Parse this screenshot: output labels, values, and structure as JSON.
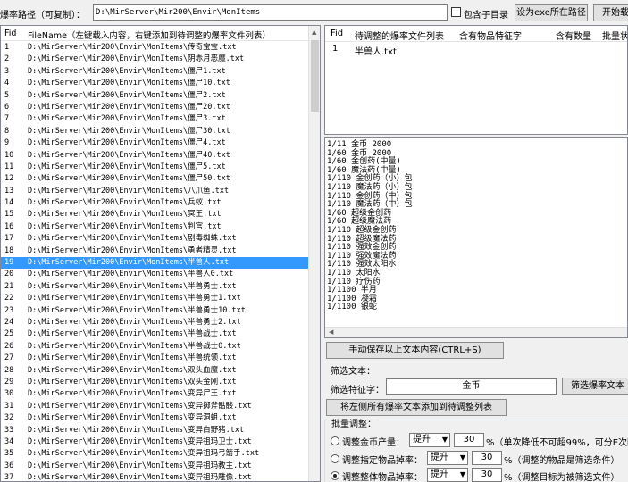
{
  "topbar": {
    "path_label": "爆率路径（可复制）：",
    "path_value": "D:\\MirServer\\Mir200\\Envir\\MonItems",
    "include_subdir_label": "包含子目录",
    "include_subdir_checked": false,
    "set_exe_button": "设为exe所在路径",
    "start_button": "开始载"
  },
  "left_list": {
    "headers": {
      "fid": "Fid",
      "filename": "FileName（左键载入内容，右键添加到待调整的爆率文件列表）"
    },
    "selected_fid": "19",
    "rows": [
      {
        "fid": "1",
        "name": "D:\\MirServer\\Mir200\\Envir\\MonItems\\传奇宝宝.txt"
      },
      {
        "fid": "2",
        "name": "D:\\MirServer\\Mir200\\Envir\\MonItems\\阴赤月恶魔.txt"
      },
      {
        "fid": "3",
        "name": "D:\\MirServer\\Mir200\\Envir\\MonItems\\僵尸1.txt"
      },
      {
        "fid": "4",
        "name": "D:\\MirServer\\Mir200\\Envir\\MonItems\\僵尸10.txt"
      },
      {
        "fid": "5",
        "name": "D:\\MirServer\\Mir200\\Envir\\MonItems\\僵尸2.txt"
      },
      {
        "fid": "6",
        "name": "D:\\MirServer\\Mir200\\Envir\\MonItems\\僵尸20.txt"
      },
      {
        "fid": "7",
        "name": "D:\\MirServer\\Mir200\\Envir\\MonItems\\僵尸3.txt"
      },
      {
        "fid": "8",
        "name": "D:\\MirServer\\Mir200\\Envir\\MonItems\\僵尸30.txt"
      },
      {
        "fid": "9",
        "name": "D:\\MirServer\\Mir200\\Envir\\MonItems\\僵尸4.txt"
      },
      {
        "fid": "10",
        "name": "D:\\MirServer\\Mir200\\Envir\\MonItems\\僵尸40.txt"
      },
      {
        "fid": "11",
        "name": "D:\\MirServer\\Mir200\\Envir\\MonItems\\僵尸5.txt"
      },
      {
        "fid": "12",
        "name": "D:\\MirServer\\Mir200\\Envir\\MonItems\\僵尸50.txt"
      },
      {
        "fid": "13",
        "name": "D:\\MirServer\\Mir200\\Envir\\MonItems\\八爪鱼.txt"
      },
      {
        "fid": "14",
        "name": "D:\\MirServer\\Mir200\\Envir\\MonItems\\兵蚁.txt"
      },
      {
        "fid": "15",
        "name": "D:\\MirServer\\Mir200\\Envir\\MonItems\\冥王.txt"
      },
      {
        "fid": "16",
        "name": "D:\\MirServer\\Mir200\\Envir\\MonItems\\判官.txt"
      },
      {
        "fid": "17",
        "name": "D:\\MirServer\\Mir200\\Envir\\MonItems\\剧毒蜘蛛.txt"
      },
      {
        "fid": "18",
        "name": "D:\\MirServer\\Mir200\\Envir\\MonItems\\勇者精灵.txt"
      },
      {
        "fid": "19",
        "name": "D:\\MirServer\\Mir200\\Envir\\MonItems\\半兽人.txt"
      },
      {
        "fid": "20",
        "name": "D:\\MirServer\\Mir200\\Envir\\MonItems\\半兽人0.txt"
      },
      {
        "fid": "21",
        "name": "D:\\MirServer\\Mir200\\Envir\\MonItems\\半兽勇士.txt"
      },
      {
        "fid": "22",
        "name": "D:\\MirServer\\Mir200\\Envir\\MonItems\\半兽勇士1.txt"
      },
      {
        "fid": "23",
        "name": "D:\\MirServer\\Mir200\\Envir\\MonItems\\半兽勇士10.txt"
      },
      {
        "fid": "24",
        "name": "D:\\MirServer\\Mir200\\Envir\\MonItems\\半兽勇士2.txt"
      },
      {
        "fid": "25",
        "name": "D:\\MirServer\\Mir200\\Envir\\MonItems\\半兽战士.txt"
      },
      {
        "fid": "26",
        "name": "D:\\MirServer\\Mir200\\Envir\\MonItems\\半兽战士0.txt"
      },
      {
        "fid": "27",
        "name": "D:\\MirServer\\Mir200\\Envir\\MonItems\\半兽统领.txt"
      },
      {
        "fid": "28",
        "name": "D:\\MirServer\\Mir200\\Envir\\MonItems\\双头血魔.txt"
      },
      {
        "fid": "29",
        "name": "D:\\MirServer\\Mir200\\Envir\\MonItems\\双头金刚.txt"
      },
      {
        "fid": "30",
        "name": "D:\\MirServer\\Mir200\\Envir\\MonItems\\变异尸王.txt"
      },
      {
        "fid": "31",
        "name": "D:\\MirServer\\Mir200\\Envir\\MonItems\\变异掷斧骷髅.txt"
      },
      {
        "fid": "32",
        "name": "D:\\MirServer\\Mir200\\Envir\\MonItems\\变异洞蛆.txt"
      },
      {
        "fid": "33",
        "name": "D:\\MirServer\\Mir200\\Envir\\MonItems\\变异白野猪.txt"
      },
      {
        "fid": "34",
        "name": "D:\\MirServer\\Mir200\\Envir\\MonItems\\变异祖玛卫士.txt"
      },
      {
        "fid": "35",
        "name": "D:\\MirServer\\Mir200\\Envir\\MonItems\\变异祖玛弓箭手.txt"
      },
      {
        "fid": "36",
        "name": "D:\\MirServer\\Mir200\\Envir\\MonItems\\变异祖玛教主.txt"
      },
      {
        "fid": "37",
        "name": "D:\\MirServer\\Mir200\\Envir\\MonItems\\变异祖玛雕像.txt"
      }
    ]
  },
  "pending_table": {
    "headers": [
      "Fid",
      "待调整的爆率文件列表",
      "含有物品特征字",
      "含有数量",
      "批量状"
    ],
    "rows": [
      {
        "fid": "1",
        "file": "半兽人.txt",
        "code": "",
        "count": ""
      }
    ]
  },
  "content_lines": [
    "1/11 金币 2000",
    "1/60 金币 2000",
    "1/60 金创药(中量)",
    "1/60 魔法药(中量)",
    "1/110 金创药（小）包",
    "1/110 魔法药（小）包",
    "1/110 金创药（中）包",
    "1/110 魔法药（中）包",
    "1/60 超级金创药",
    "1/60 超级魔法药",
    "1/110 超级金创药",
    "1/110 超级魔法药",
    "1/110 强效金创药",
    "1/110 强效魔法药",
    "1/110 强效太阳水",
    "1/110 太阳水",
    "1/110 疗伤药",
    "1/1100 半月",
    "1/1100 凝霜",
    "1/1100 银蛇"
  ],
  "actions": {
    "save_button": "手动保存以上文本内容(CTRL+S)",
    "filter_text_label": "筛选文本：",
    "filter_code_label": "筛选特征字：",
    "filter_code_value": "金币",
    "filter_button": "筛选爆率文本",
    "add_all_button": "将左侧所有爆率文本添加到待调整列表"
  },
  "batch": {
    "title": "批量调整：",
    "options": [
      {
        "label": "调整金币产量：",
        "mode": "提升",
        "value": "30",
        "desc": "%（单次降低不可超99%，可分E次降低",
        "selected": false
      },
      {
        "label": "调整指定物品掉率：",
        "mode": "提升",
        "value": "30",
        "desc": "%（调整的物品是筛选条件）",
        "selected": false
      },
      {
        "label": "调整整体物品掉率：",
        "mode": "提升",
        "value": "30",
        "desc": "%（调整目标为被筛选文件）",
        "selected": true
      }
    ]
  }
}
